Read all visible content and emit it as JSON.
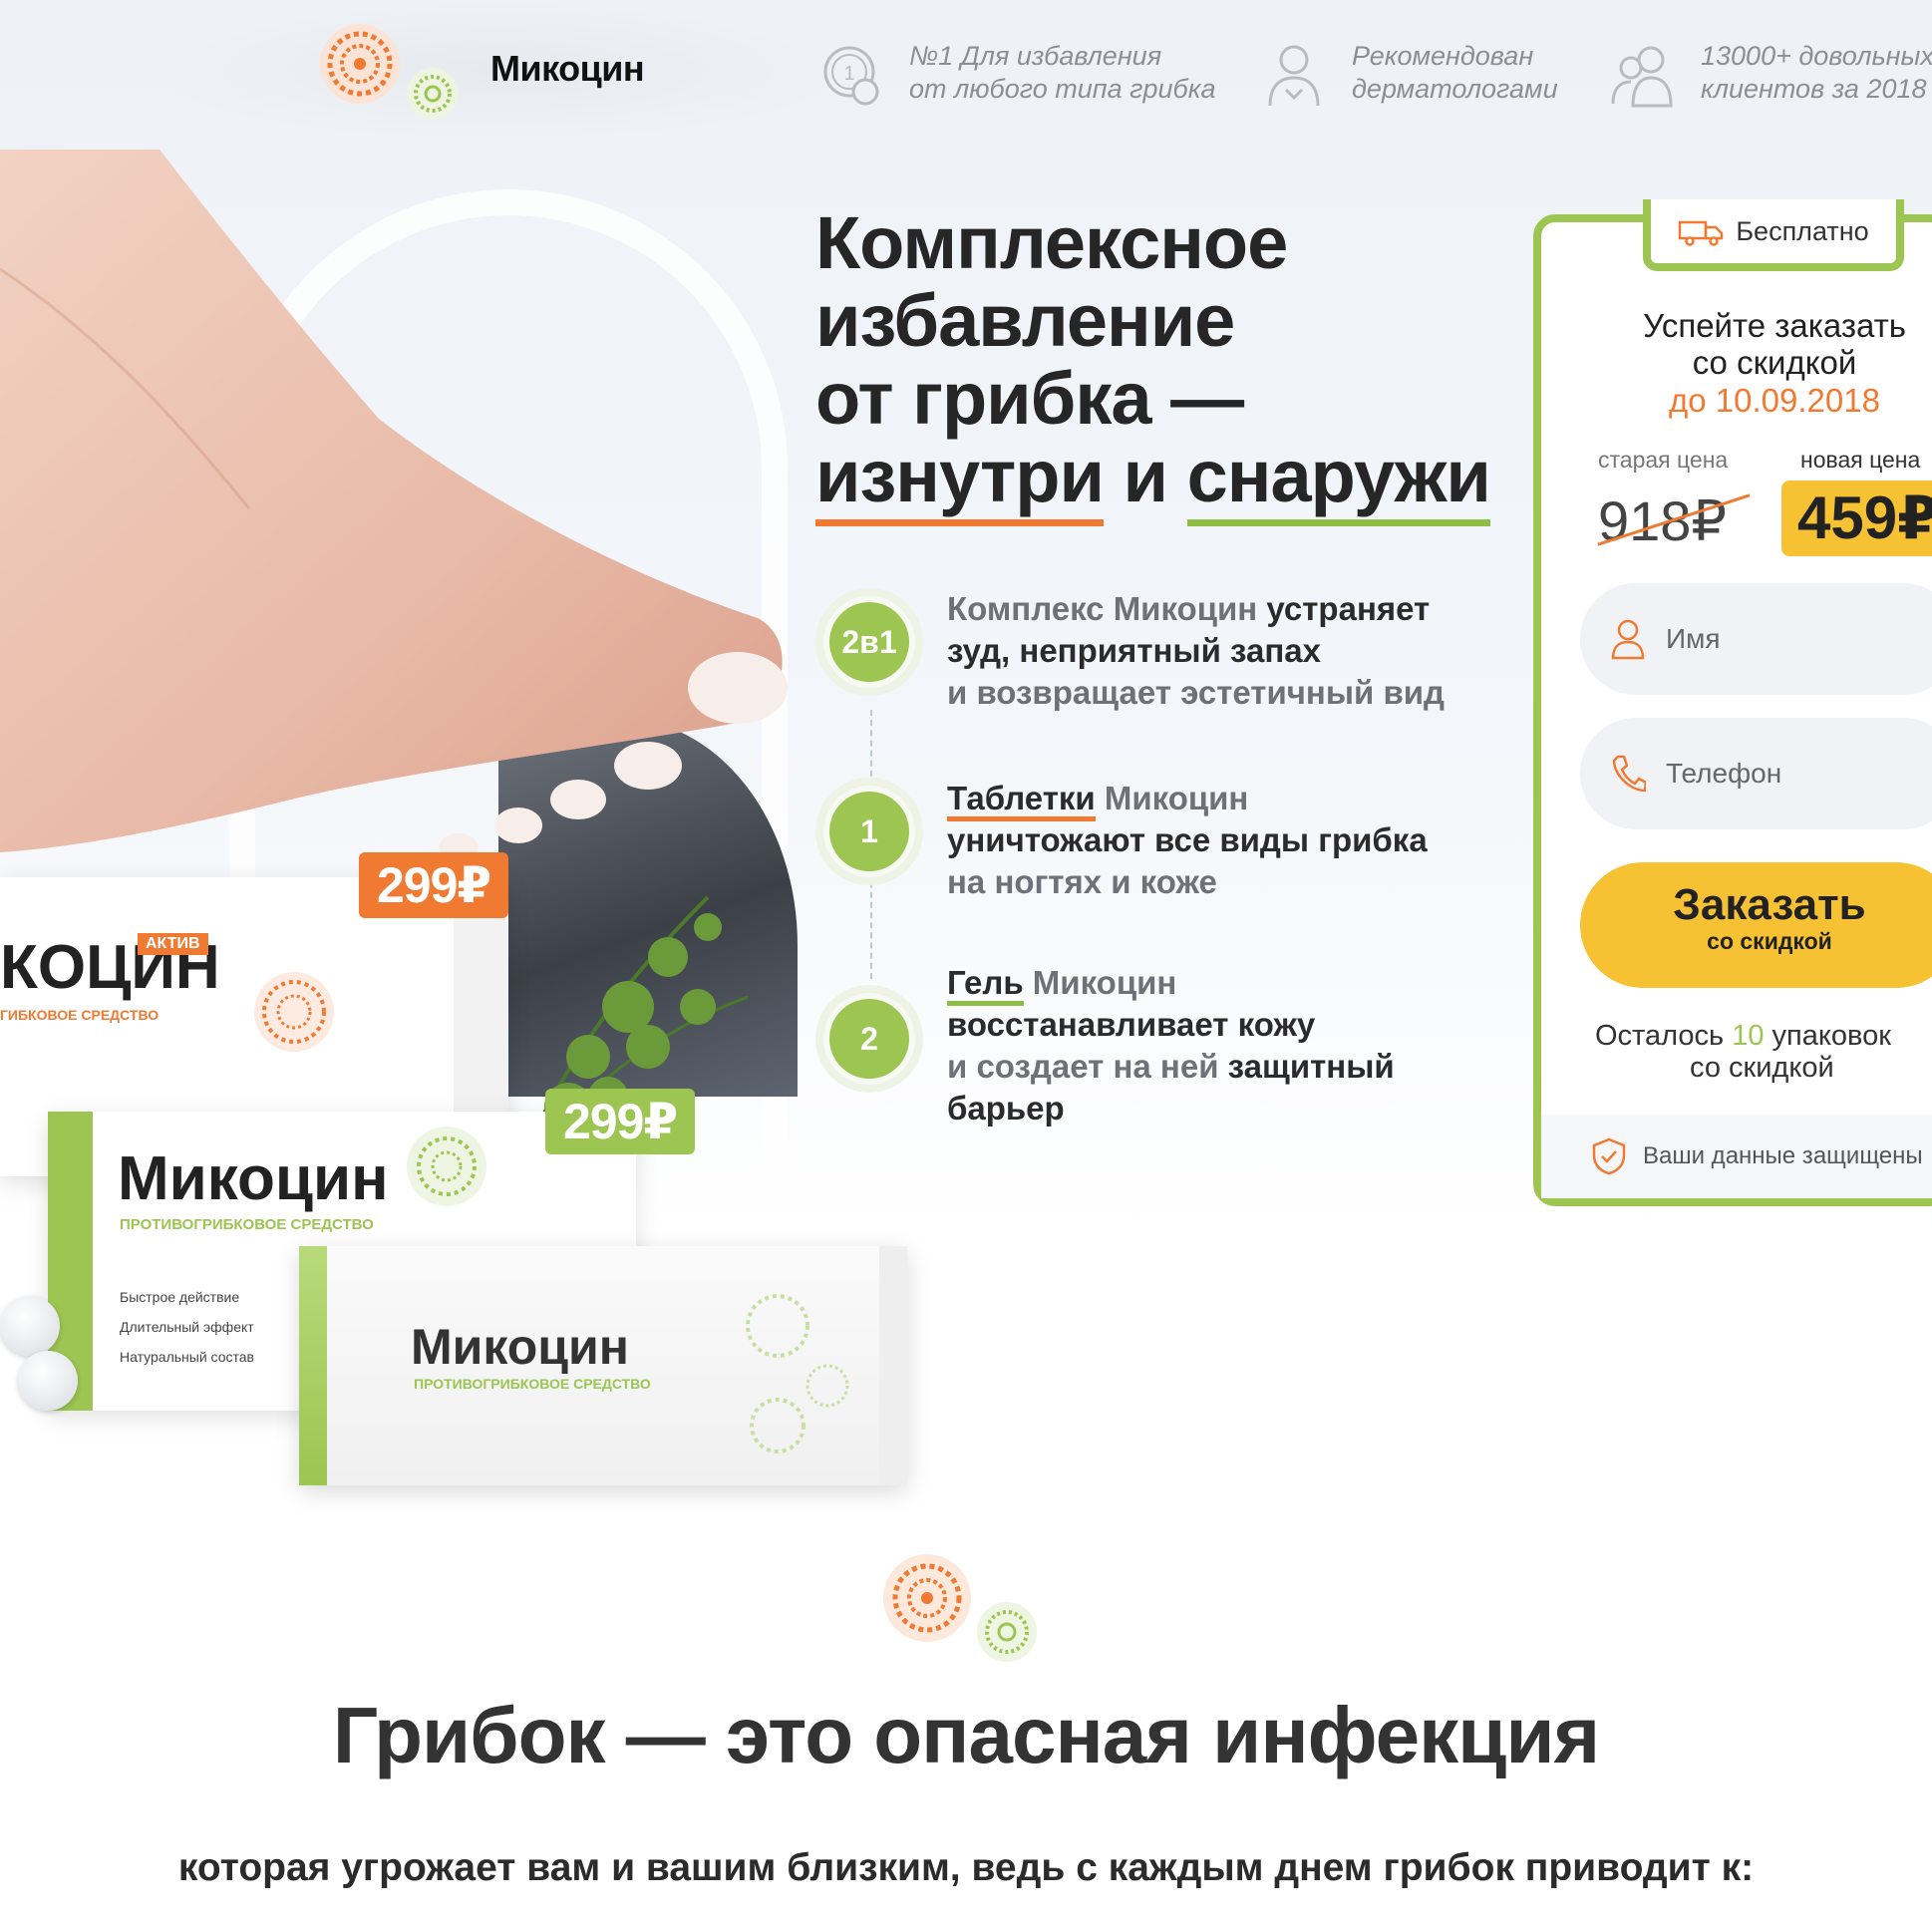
{
  "header": {
    "brand": "Микоцин",
    "badges": [
      {
        "icon": "medal-icon",
        "line1": "№1 Для избавления",
        "line2": "от любого типа грибка"
      },
      {
        "icon": "doctor-icon",
        "line1": "Рекомендован",
        "line2": "дерматологами"
      },
      {
        "icon": "customers-icon",
        "line1": "13000+ довольных",
        "line2": "клиентов за 2018"
      }
    ]
  },
  "hero": {
    "headline": {
      "line1": "Комплексное",
      "line2": "избавление",
      "line3": "от грибка —",
      "word_inside": "изнутри",
      "word_and": "и",
      "word_outside": "снаружи"
    },
    "steps": [
      {
        "badge": "2в1",
        "a": "Комплекс Микоцин",
        "b": " устраняет",
        "c": "зуд, неприятный запах",
        "d": "и возвращает эстетичный вид"
      },
      {
        "badge": "1",
        "a": "Таблетки",
        "b": " Микоцин",
        "c": "уничтожают все виды грибка",
        "d": "на ногтях и коже"
      },
      {
        "badge": "2",
        "a": "Гель",
        "b": " Микоцин",
        "c": "восстанавливает кожу",
        "d": "и создает на ней",
        "e": " защитный",
        "f": "барьер"
      }
    ],
    "price_tags": {
      "tablets": "299₽",
      "gel": "299₽"
    },
    "products": {
      "box1_name": "КОЦИН",
      "box1_badge": "АКТИВ",
      "box1_sub": "ГИБКОВОЕ СРЕДСТВО",
      "box2_name": "Микоцин",
      "box2_sub": "ПРОТИВОГРИБКОВОЕ СРЕДСТВО",
      "box2_list": [
        "Быстрое действие",
        "Длительный эффект",
        "Натуральный состав"
      ],
      "sachet_name": "Микоцин",
      "sachet_sub": "ПРОТИВОГРИБКОВОЕ СРЕДСТВО"
    }
  },
  "order_form": {
    "free_delivery": "Бесплатно",
    "title_line1": "Успейте заказать",
    "title_line2": "со скидкой",
    "deadline": "до 10.09.2018",
    "old_label": "старая цена",
    "new_label": "новая цена",
    "old_price": "918₽",
    "new_price": "459₽",
    "name_placeholder": "Имя",
    "phone_placeholder": "Телефон",
    "button_line1": "Заказать",
    "button_line2": "со скидкой",
    "remaining_pre": "Осталось ",
    "remaining_count": "10",
    "remaining_post": " упаковок",
    "remaining_line2": "со скидкой",
    "secure_text": "Ваши данные защищены"
  },
  "section2": {
    "title": "Грибок — это опасная инфекция",
    "subtitle": "которая угрожает вам и вашим близким, ведь с каждым днем грибок приводит к:"
  },
  "colors": {
    "orange": "#f07a32",
    "green": "#9cc552",
    "yellow": "#f6c233"
  }
}
